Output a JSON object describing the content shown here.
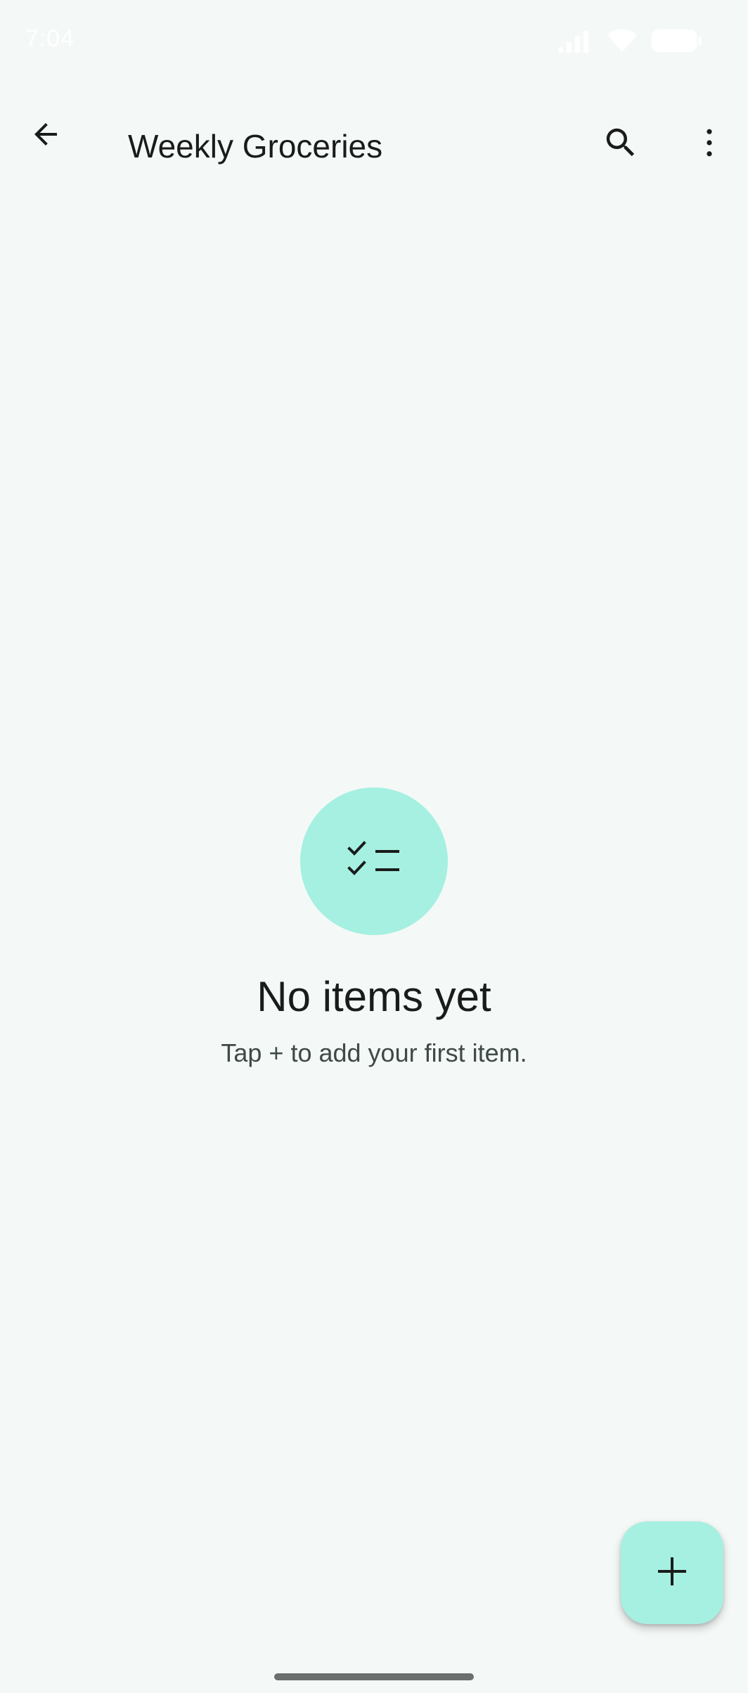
{
  "status_bar": {
    "time": "7:04",
    "icons": [
      "signal-icon",
      "wifi-icon",
      "battery-icon"
    ]
  },
  "app_bar": {
    "title": "Weekly Groceries",
    "icons": {
      "back": "arrow-back-icon",
      "search": "search-icon",
      "more": "more-vert-icon"
    }
  },
  "empty_state": {
    "icon": "checklist-icon",
    "title": "No items yet",
    "subtitle": "Tap + to add your first item."
  },
  "fab": {
    "icon": "plus-icon"
  },
  "colors": {
    "background": "#f4f9f7",
    "accent_container": "#a5f0e1",
    "on_surface": "#1a1c1b",
    "on_surface_variant": "#3f4946"
  }
}
